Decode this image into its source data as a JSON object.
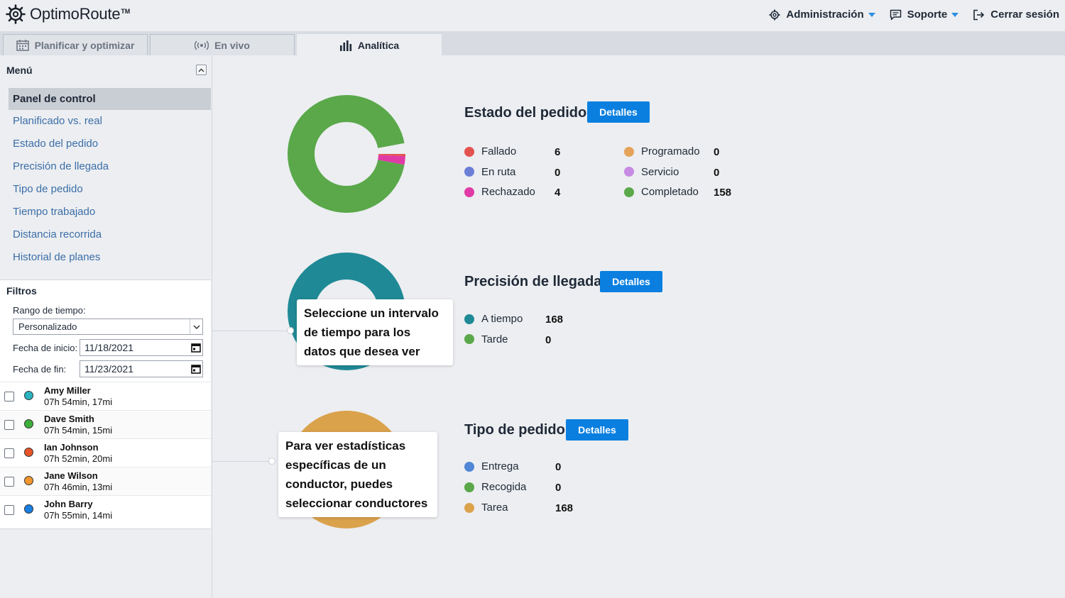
{
  "app": {
    "logo_text": "OptimoRoute",
    "logo_tm": "TM"
  },
  "topnav": {
    "admin_label": "Administración",
    "support_label": "Soporte",
    "logout_label": "Cerrar sesión"
  },
  "tabs": [
    {
      "label": "Planificar y optimizar",
      "icon": "calendar-icon"
    },
    {
      "label": "En vivo",
      "icon": "live-broadcast-icon"
    },
    {
      "label": "Analítica",
      "icon": "bar-chart-icon",
      "active": true
    }
  ],
  "sidebar": {
    "menu_title": "Menú",
    "items": [
      {
        "label": "Panel de control",
        "active": true
      },
      {
        "label": "Planificado vs. real"
      },
      {
        "label": "Estado del pedido"
      },
      {
        "label": "Precisión de llegada"
      },
      {
        "label": "Tipo de pedido"
      },
      {
        "label": "Tiempo trabajado"
      },
      {
        "label": "Distancia recorrida"
      },
      {
        "label": "Historial de planes"
      }
    ]
  },
  "filters": {
    "title": "Filtros",
    "range_label": "Rango de tiempo:",
    "range_value": "Personalizado",
    "start_label": "Fecha de inicio:",
    "start_value": "11/18/2021",
    "end_label": "Fecha de fin:",
    "end_value": "11/23/2021"
  },
  "drivers": [
    {
      "name": "Amy Miller",
      "stats": "07h 54min, 17mi",
      "color": "#2bb3c0"
    },
    {
      "name": "Dave Smith",
      "stats": "07h 54min, 15mi",
      "color": "#3dae3a"
    },
    {
      "name": "Ian Johnson",
      "stats": "07h 52min, 20mi",
      "color": "#e8542a"
    },
    {
      "name": "Jane Wilson",
      "stats": "07h 46min, 13mi",
      "color": "#f0962d"
    },
    {
      "name": "John Barry",
      "stats": "07h 55min, 14mi",
      "color": "#1a7fe0"
    }
  ],
  "sections": {
    "order_status": {
      "title": "Estado del pedido",
      "details_label": "Detalles",
      "legend": [
        {
          "label": "Fallado",
          "value": "6",
          "color": "#e4524f"
        },
        {
          "label": "En ruta",
          "value": "0",
          "color": "#6b7fd6"
        },
        {
          "label": "Rechazado",
          "value": "4",
          "color": "#e03aa6"
        },
        {
          "label": "Programado",
          "value": "0",
          "color": "#e5a35a"
        },
        {
          "label": "Servicio",
          "value": "0",
          "color": "#c78be3"
        },
        {
          "label": "Completado",
          "value": "158",
          "color": "#5aa84a"
        }
      ]
    },
    "arrival_accuracy": {
      "title": "Precisión de llegada",
      "details_label": "Detalles",
      "legend": [
        {
          "label": "A tiempo",
          "value": "168",
          "color": "#1f8a96"
        },
        {
          "label": "Tarde",
          "value": "0",
          "color": "#5aa84a"
        }
      ]
    },
    "order_type": {
      "title": "Tipo de pedido",
      "details_label": "Detalles",
      "legend": [
        {
          "label": "Entrega",
          "value": "0",
          "color": "#4f86d6"
        },
        {
          "label": "Recogida",
          "value": "0",
          "color": "#5aa84a"
        },
        {
          "label": "Tarea",
          "value": "168",
          "color": "#dba24c"
        }
      ]
    }
  },
  "tooltips": {
    "time_range": "Seleccione un intervalo de tiempo para los datos que desea ver",
    "drivers": "Para ver estadísticas específicas de un conductor, puedes seleccionar conductores"
  },
  "chart_data": [
    {
      "type": "pie",
      "title": "Estado del pedido",
      "categories": [
        "Fallado",
        "En ruta",
        "Rechazado",
        "Programado",
        "Servicio",
        "Completado"
      ],
      "values": [
        6,
        0,
        4,
        0,
        0,
        158
      ]
    },
    {
      "type": "pie",
      "title": "Precisión de llegada",
      "categories": [
        "A tiempo",
        "Tarde"
      ],
      "values": [
        168,
        0
      ]
    },
    {
      "type": "pie",
      "title": "Tipo de pedido",
      "categories": [
        "Entrega",
        "Recogida",
        "Tarea"
      ],
      "values": [
        0,
        0,
        168
      ]
    }
  ]
}
